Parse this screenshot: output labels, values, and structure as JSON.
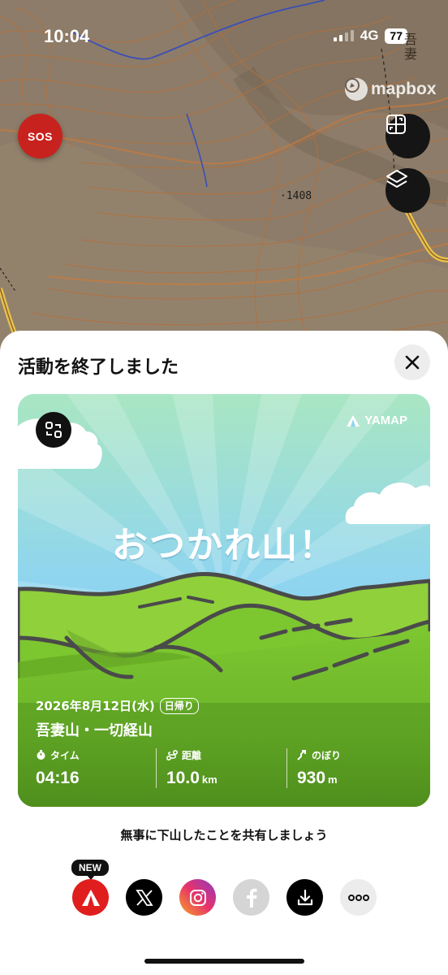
{
  "status_bar": {
    "time": "10:04",
    "network": "4G",
    "battery": "77"
  },
  "map": {
    "attribution": "mapbox",
    "elevation_label": "·1408",
    "road_label": "吾妻",
    "sos_label": "SOS",
    "buttons": [
      "exit-fullscreen-icon",
      "layers-icon"
    ],
    "colors": {
      "terrain": "#8d7c69",
      "contour": "#b2703e",
      "river": "#3b4fb8",
      "road": "#e8c34a"
    }
  },
  "sheet": {
    "title": "活動を終了しました",
    "close_icon": "close-icon"
  },
  "card": {
    "brand": "YAMAP",
    "headline": "おつかれ山！",
    "date": "2026年8月12日(水)",
    "trip_type": "日帰り",
    "mountain": "吾妻山・一切経山",
    "stats": [
      {
        "label": "タイム",
        "value": "04:16",
        "unit": "",
        "icon": "timer-icon"
      },
      {
        "label": "距離",
        "value": "10.0",
        "unit": "km",
        "icon": "route-icon"
      },
      {
        "label": "のぼり",
        "value": "930",
        "unit": "m",
        "icon": "ascent-icon"
      }
    ],
    "colors": {
      "sky": "#8fd5ef",
      "ridge": "#7cc630",
      "ground": "#6ab42a",
      "outline": "#4a4a4a"
    }
  },
  "share": {
    "caption": "無事に下山したことを共有しましょう",
    "new_badge": "NEW",
    "targets": [
      "yamap-icon",
      "x-icon",
      "instagram-icon",
      "facebook-icon",
      "download-icon",
      "more-icon"
    ]
  }
}
